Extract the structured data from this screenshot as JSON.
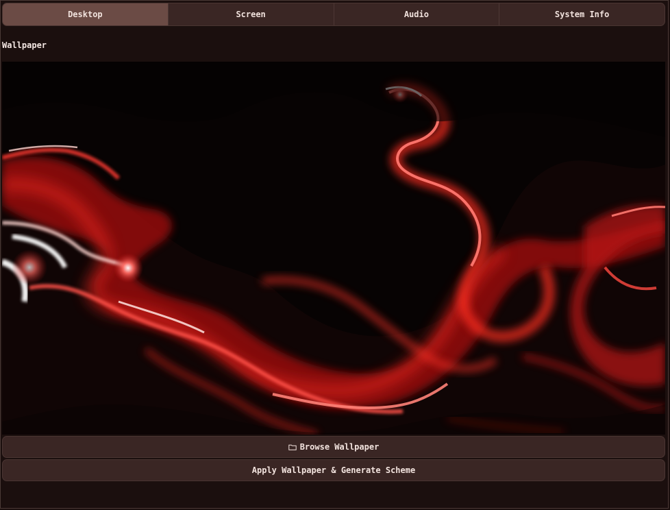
{
  "tabs": [
    {
      "label": "Desktop",
      "active": true
    },
    {
      "label": "Screen",
      "active": false
    },
    {
      "label": "Audio",
      "active": false
    },
    {
      "label": "System Info",
      "active": false
    }
  ],
  "wallpaper": {
    "section_label": "Wallpaper",
    "image_description_icon": "abstract-red-fluid-wallpaper"
  },
  "buttons": {
    "browse_label": "Browse Wallpaper",
    "browse_icon": "folder-icon",
    "apply_label": "Apply Wallpaper & Generate Scheme"
  },
  "colors": {
    "background": "#1b0f0e",
    "tab_bar": "#3a2624",
    "tab_active": "#6b4b45",
    "button": "#3a2624",
    "text": "#f3e4df",
    "accent_red": "#e3261d"
  }
}
